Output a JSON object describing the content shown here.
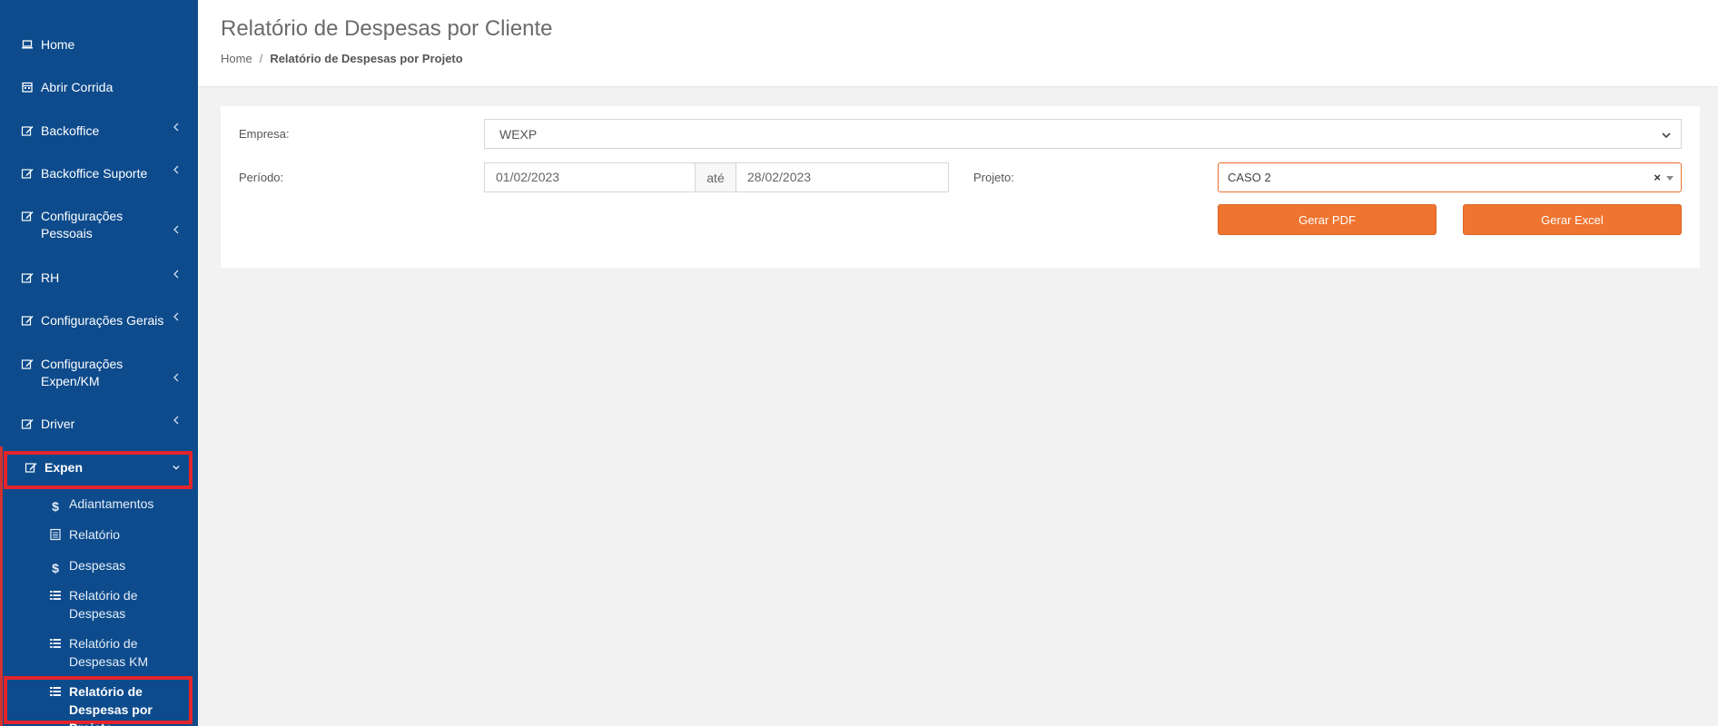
{
  "sidebar": {
    "items": [
      {
        "label": "Home",
        "icon": "laptop-icon"
      },
      {
        "label": "Abrir Corrida",
        "icon": "calendar-icon"
      },
      {
        "label": "Backoffice",
        "icon": "edit-icon"
      },
      {
        "label": "Backoffice Suporte",
        "icon": "edit-icon"
      },
      {
        "label": "Configurações Pessoais",
        "icon": "edit-icon"
      },
      {
        "label": "RH",
        "icon": "edit-icon"
      },
      {
        "label": "Configurações Gerais",
        "icon": "edit-icon"
      },
      {
        "label": "Configurações Expen/KM",
        "icon": "edit-icon"
      },
      {
        "label": "Driver",
        "icon": "edit-icon"
      },
      {
        "label": "Expen",
        "icon": "edit-icon"
      }
    ],
    "subitems": [
      {
        "label": "Adiantamentos",
        "icon": "dollar-icon"
      },
      {
        "label": "Relatório",
        "icon": "document-icon"
      },
      {
        "label": "Despesas",
        "icon": "dollar-icon"
      },
      {
        "label": "Relatório de Despesas",
        "icon": "list-icon"
      },
      {
        "label": "Relatório de Despesas KM",
        "icon": "list-icon"
      },
      {
        "label": "Relatório de Despesas por Projeto",
        "icon": "list-icon"
      }
    ]
  },
  "header": {
    "title": "Relatório de Despesas por Cliente",
    "breadcrumb": {
      "home": "Home",
      "separator": "/",
      "current": "Relatório de Despesas por Projeto"
    }
  },
  "form": {
    "empresa_label": "Empresa:",
    "empresa_value": "WEXP",
    "periodo_label": "Período:",
    "date_start": "01/02/2023",
    "date_sep": "até",
    "date_end": "28/02/2023",
    "projeto_label": "Projeto:",
    "projeto_value": "CASO 2",
    "projeto_clear": "×",
    "btn_pdf": "Gerar PDF",
    "btn_excel": "Gerar Excel"
  },
  "colors": {
    "sidebar_bg": "#0d4b8c",
    "accent": "#ee7430",
    "highlight_border": "#e4242b"
  }
}
